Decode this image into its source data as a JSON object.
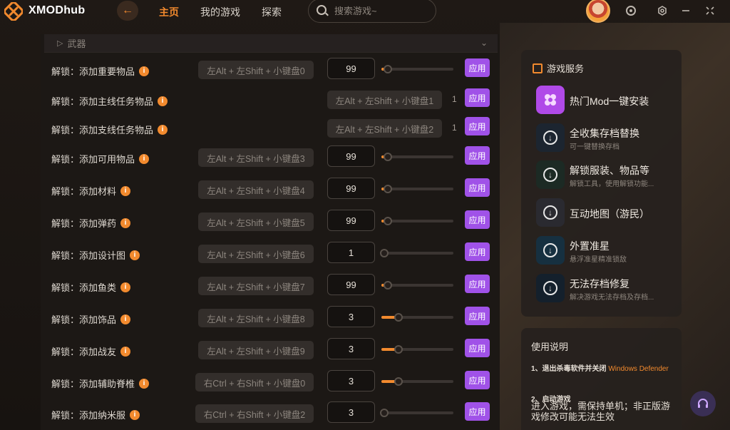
{
  "header": {
    "logo_text": "XMODhub",
    "nav": [
      {
        "label": "主页",
        "active": true
      },
      {
        "label": "我的游戏",
        "active": false
      },
      {
        "label": "探索",
        "active": false
      }
    ],
    "search_placeholder": "搜索游戏~",
    "accent_color": "#f28a2e"
  },
  "section": {
    "label": "武器"
  },
  "rows": [
    {
      "name": "解锁：添加重要物品",
      "hotkey": "左Alt + 左Shift + 小键盘0",
      "value": "99",
      "slider": 0.05,
      "apply": "应用"
    },
    {
      "name": "解锁：添加主线任务物品",
      "hotkey": "左Alt + 左Shift + 小键盘1",
      "count": "1",
      "apply": "应用"
    },
    {
      "name": "解锁：添加支线任务物品",
      "hotkey": "左Alt + 左Shift + 小键盘2",
      "count": "1",
      "apply": "应用"
    },
    {
      "name": "解锁：添加可用物品",
      "hotkey": "左Alt + 左Shift + 小键盘3",
      "value": "99",
      "slider": 0.05,
      "apply": "应用"
    },
    {
      "name": "解锁：添加材料",
      "hotkey": "左Alt + 左Shift + 小键盘4",
      "value": "99",
      "slider": 0.05,
      "apply": "应用"
    },
    {
      "name": "解锁：添加弹药",
      "hotkey": "左Alt + 左Shift + 小键盘5",
      "value": "99",
      "slider": 0.05,
      "apply": "应用"
    },
    {
      "name": "解锁：添加设计图",
      "hotkey": "左Alt + 左Shift + 小键盘6",
      "value": "1",
      "slider": 0.0,
      "apply": "应用"
    },
    {
      "name": "解锁：添加鱼类",
      "hotkey": "左Alt + 左Shift + 小键盘7",
      "value": "99",
      "slider": 0.05,
      "apply": "应用"
    },
    {
      "name": "解锁：添加饰品",
      "hotkey": "左Alt + 左Shift + 小键盘8",
      "value": "3",
      "slider": 0.2,
      "apply": "应用"
    },
    {
      "name": "解锁：添加战友",
      "hotkey": "左Alt + 左Shift + 小键盘9",
      "value": "3",
      "slider": 0.2,
      "apply": "应用"
    },
    {
      "name": "解锁：添加辅助脊椎",
      "hotkey": "右Ctrl + 右Shift + 小键盘0",
      "value": "3",
      "slider": 0.2,
      "apply": "应用"
    },
    {
      "name": "解锁：添加纳米服",
      "hotkey": "右Ctrl + 右Shift + 小键盘2",
      "value": "3",
      "slider": 0.0,
      "apply": "应用"
    }
  ],
  "services": {
    "title": "游戏服务",
    "items": [
      {
        "title": "热门Mod一键安装",
        "subtitle": "",
        "icon": "mod-flower-icon"
      },
      {
        "title": "全收集存档替换",
        "subtitle": "可一键替换存档",
        "icon": "download-icon"
      },
      {
        "title": "解锁服装、物品等",
        "subtitle": "解锁工具，使用解锁功能...",
        "icon": "download-icon"
      },
      {
        "title": "互动地图（游民）",
        "subtitle": "",
        "icon": "download-icon"
      },
      {
        "title": "外置准星",
        "subtitle": "悬浮准星精准锁敌",
        "icon": "download-icon"
      },
      {
        "title": "无法存档修复",
        "subtitle": "解决游戏无法存档及存档...",
        "icon": "download-icon"
      }
    ]
  },
  "guide": {
    "title": "使用说明",
    "step1_prefix": "1、退出杀毒软件并关闭 ",
    "step1_highlight": "Windows Defender",
    "step2": "2、启动游戏",
    "step2_desc": "进入游戏，需保持单机；非正版游戏修改可能无法生效"
  }
}
